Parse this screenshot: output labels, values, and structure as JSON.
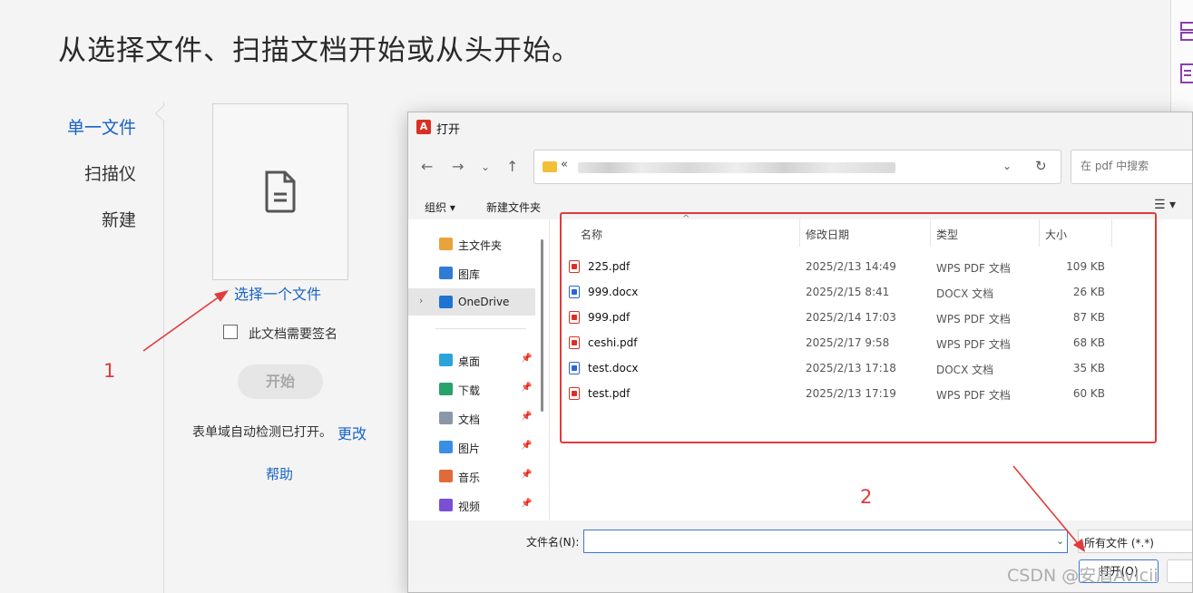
{
  "app": {
    "heading": "从选择文件、扫描文档开始或从头开始。",
    "nav": [
      "单一文件",
      "扫描仪",
      "新建"
    ],
    "choose_file": "选择一个文件",
    "sign_checkbox_label": "此文档需要签名",
    "start_button": "开始",
    "forms_note": "表单域自动检测已打开。",
    "forms_change": "更改",
    "help": "帮助"
  },
  "annotations": {
    "step1": "1",
    "step2": "2"
  },
  "dialog": {
    "title": "打开",
    "address_prefix": "«",
    "search_placeholder": "在 pdf 中搜索",
    "toolbar": {
      "organize": "组织 ▾",
      "new_folder": "新建文件夹"
    },
    "nav_pane": [
      {
        "label": "主文件夹",
        "icon": "home-icon",
        "color": "#e8a33b",
        "pinned": false
      },
      {
        "label": "图库",
        "icon": "gallery-icon",
        "color": "#2f7bd6",
        "pinned": false
      },
      {
        "label": "OneDrive",
        "icon": "onedrive-icon",
        "color": "#1f74d1",
        "pinned": false,
        "selected": true
      },
      {
        "label": "桌面",
        "icon": "desktop-icon",
        "color": "#2aa3d9",
        "pinned": true
      },
      {
        "label": "下载",
        "icon": "download-icon",
        "color": "#27a36a",
        "pinned": true
      },
      {
        "label": "文档",
        "icon": "documents-icon",
        "color": "#8a97a8",
        "pinned": true
      },
      {
        "label": "图片",
        "icon": "pictures-icon",
        "color": "#3a8ee6",
        "pinned": true
      },
      {
        "label": "音乐",
        "icon": "music-icon",
        "color": "#e06a3a",
        "pinned": true
      },
      {
        "label": "视频",
        "icon": "video-icon",
        "color": "#7a4fd6",
        "pinned": true
      }
    ],
    "columns": {
      "name": "名称",
      "date": "修改日期",
      "type": "类型",
      "size": "大小"
    },
    "files": [
      {
        "name": "225.pdf",
        "date": "2025/2/13 14:49",
        "type": "WPS PDF 文档",
        "size": "109 KB",
        "kind": "pdf"
      },
      {
        "name": "999.docx",
        "date": "2025/2/15 8:41",
        "type": "DOCX 文档",
        "size": "26 KB",
        "kind": "doc"
      },
      {
        "name": "999.pdf",
        "date": "2025/2/14 17:03",
        "type": "WPS PDF 文档",
        "size": "87 KB",
        "kind": "pdf"
      },
      {
        "name": "ceshi.pdf",
        "date": "2025/2/17 9:58",
        "type": "WPS PDF 文档",
        "size": "68 KB",
        "kind": "pdf"
      },
      {
        "name": "test.docx",
        "date": "2025/2/13 17:18",
        "type": "DOCX 文档",
        "size": "35 KB",
        "kind": "doc"
      },
      {
        "name": "test.pdf",
        "date": "2025/2/13 17:19",
        "type": "WPS PDF 文档",
        "size": "60 KB",
        "kind": "pdf"
      }
    ],
    "filename_label": "文件名(N):",
    "filename_value": "",
    "filter": "所有文件 (*.*)",
    "open_button": "打开(O)"
  },
  "watermark": "CSDN @安眉Avicii"
}
